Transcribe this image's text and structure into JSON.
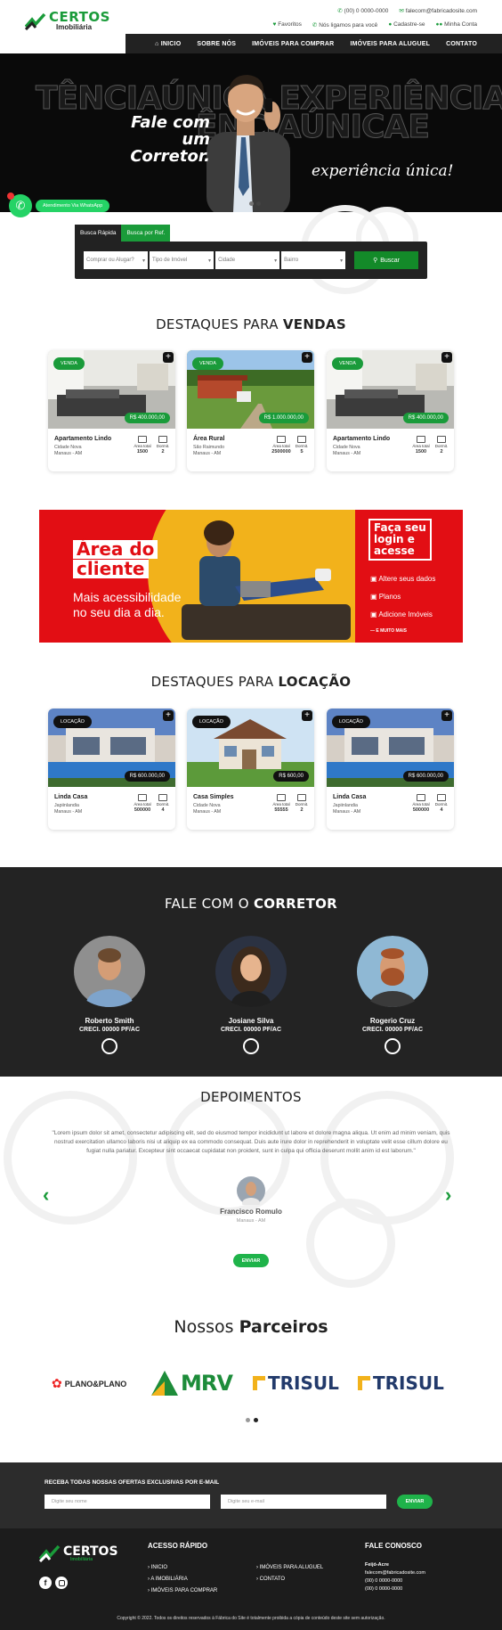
{
  "brand": {
    "name": "CERTOS",
    "sub": "Imobiliária",
    "accent": "#1a9b3a"
  },
  "topbar": {
    "phone": "(00) 0 0000-0000",
    "email": "falecom@fabricadosite.com",
    "favorites": "Favoritos",
    "callback": "Nós ligamos para você",
    "register": "Cadastre-se",
    "account": "Minha Conta"
  },
  "nav": [
    "INICIO",
    "SOBRE NÓS",
    "IMÓVEIS PARA COMPRAR",
    "IMÓVEIS PARA ALUGUEL",
    "CONTATO"
  ],
  "hero": {
    "headline": "Fale com um Corretor.",
    "tagline": "experiência única!",
    "bg1": "TÊNCIAÚNICA EXPERIÊNCIA",
    "bg2": "ÊNCIAÚNICAE"
  },
  "whatsapp": {
    "label": "Atendimento Via WhatsApp"
  },
  "search": {
    "tab1": "Busca Rápida",
    "tab2": "Busca por Ref.",
    "f1": "Comprar ou Alugar?",
    "f2": "Tipo de Imóvel",
    "f3": "Cidade",
    "f4": "Bairro",
    "button": "Buscar"
  },
  "sales": {
    "title_a": "DESTAQUES PARA ",
    "title_b": "VENDAS",
    "items": [
      {
        "tag": "VENDA",
        "price": "R$ 400.000,00",
        "title": "Apartamento Lindo",
        "district": "Cidade Nova",
        "city": "Manaus - AM",
        "l1": "Área total",
        "v1": "1500",
        "l2": "Dormit.",
        "v2": "2"
      },
      {
        "tag": "VENDA",
        "price": "R$ 1.000.000,00",
        "title": "Área Rural",
        "district": "São Raimundo",
        "city": "Manaus - AM",
        "l1": "Área total",
        "v1": "2500000",
        "l2": "Dormit.",
        "v2": "5"
      },
      {
        "tag": "VENDA",
        "price": "R$ 400.000,00",
        "title": "Apartamento Lindo",
        "district": "Cidade Nova",
        "city": "Manaus - AM",
        "l1": "Área total",
        "v1": "1500",
        "l2": "Dormit.",
        "v2": "2"
      }
    ]
  },
  "banner": {
    "t1": "Área do",
    "t2": "cliente",
    "t3": "Mais acessibilidade",
    "t4": "no seu dia a dia.",
    "r1": "Faça seu",
    "r2": "login e",
    "r3": "acesse",
    "i1": "Altere seus dados",
    "i2": "Planos",
    "i3": "Adicione Imóveis",
    "more": "E MUITO MAIS"
  },
  "rent": {
    "title_a": "DESTAQUES PARA ",
    "title_b": "LOCAÇÃO",
    "items": [
      {
        "tag": "LOCAÇÃO",
        "price": "R$ 600.000,00",
        "title": "Linda Casa",
        "district": "Japiinlandia",
        "city": "Manaus - AM",
        "l1": "Área total",
        "v1": "500000",
        "l2": "Dormit.",
        "v2": "4"
      },
      {
        "tag": "LOCAÇÃO",
        "price": "R$ 600,00",
        "title": "Casa Simples",
        "district": "Cidade Nova",
        "city": "Manaus - AM",
        "l1": "Área total",
        "v1": "55555",
        "l2": "Dormit.",
        "v2": "2"
      },
      {
        "tag": "LOCAÇÃO",
        "price": "R$ 600.000,00",
        "title": "Linda Casa",
        "district": "Japiinlandia",
        "city": "Manaus - AM",
        "l1": "Área total",
        "v1": "500000",
        "l2": "Dormit.",
        "v2": "4"
      }
    ]
  },
  "agents": {
    "title_a": "FALE COM O ",
    "title_b": "CORRETOR",
    "items": [
      {
        "name": "Roberto Smith",
        "creci": "CRECI. 00000 PF/AC"
      },
      {
        "name": "Josiane Silva",
        "creci": "CRECI. 00000 PF/AC"
      },
      {
        "name": "Rogerio Cruz",
        "creci": "CRECI. 00000 PF/AC"
      }
    ]
  },
  "testimonials": {
    "title": "DEPOIMENTOS",
    "quote": "\"Lorem ipsum dolor sit amet, consectetur adipiscing elit, sed do eiusmod tempor incididunt ut labore et dolore magna aliqua. Ut enim ad minim veniam, quis nostrud exercitation ullamco laboris nisi ut aliquip ex ea commodo consequat. Duis aute irure dolor in reprehenderit in voluptate velit esse cillum dolore eu fugiat nulla pariatur. Excepteur sint occaecat cupidatat non proident, sunt in culpa qui officia deserunt mollit anim id est laborum.\"",
    "author": "Francisco Romulo",
    "city": "Manaus - AM",
    "button": "ENVIAR"
  },
  "partners": {
    "title_a": "Nossos ",
    "title_b": "Parceiros",
    "p1": "PLANO&PLANO",
    "p2": "MRV",
    "p3": "TRISUL",
    "p4": "TRISUL"
  },
  "newsletter": {
    "title": "RECEBA TODAS NOSSAS OFERTAS EXCLUSIVAS POR E-MAIL",
    "name_ph": "Digite seu nome",
    "email_ph": "Digite seu e-mail",
    "button": "ENVIAR"
  },
  "footer": {
    "quick": "ACESSO RÁPIDO",
    "links": [
      "INICIO",
      "A IMOBILIÁRIA",
      "IMÓVEIS PARA COMPRAR",
      "IMÓVEIS PARA ALUGUEL",
      "CONTATO"
    ],
    "contact": "FALE CONOSCO",
    "company": "Feijó-Acre",
    "email": "falecom@fabricadosite.com",
    "phone1": "(00) 0 0000-0000",
    "phone2": "(00) 0 0000-0000",
    "copyright": "Copyright © 2022. Todos os direitos reservados à Fábrica do Site é totalmente proibida a cópia de conteúdo deste site sem autorização."
  }
}
